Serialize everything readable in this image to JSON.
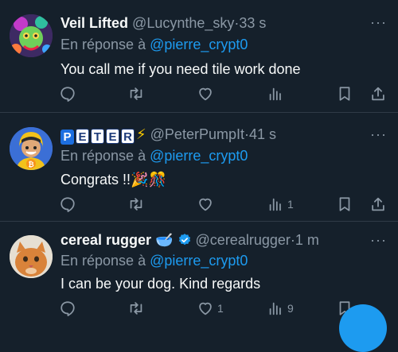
{
  "tweets": [
    {
      "name": "Veil Lifted",
      "handle": "@Lucynthe_sky",
      "time": "33 s",
      "reply_prefix": "En réponse à",
      "reply_to": "@pierre_crypt0",
      "text": "You call me if you need tile work done",
      "more": "···",
      "counts": {
        "reply": "",
        "retweet": "",
        "like": "",
        "views": ""
      }
    },
    {
      "name_letters": [
        "P",
        "E",
        "T",
        "E",
        "R"
      ],
      "name_suffix": "⚡",
      "handle": "@PeterPumpIt",
      "time": "41 s",
      "reply_prefix": "En réponse à",
      "reply_to": "@pierre_crypt0",
      "text": "Congrats !!🎉🎊",
      "more": "···",
      "counts": {
        "reply": "",
        "retweet": "",
        "like": "",
        "views": "1"
      }
    },
    {
      "name": "cereal rugger",
      "name_emoji": "🥣",
      "handle": "@cerealrugger",
      "time": "1 m",
      "reply_prefix": "En réponse à",
      "reply_to": "@pierre_crypt0",
      "text": "I can be your dog. Kind regards",
      "more": "···",
      "counts": {
        "reply": "",
        "retweet": "",
        "like": "1",
        "views": "9"
      }
    }
  ],
  "separator": "·",
  "icons": [
    "reply-icon",
    "retweet-icon",
    "like-icon",
    "views-icon",
    "bookmark-icon",
    "share-icon",
    "verified-icon"
  ],
  "colors": {
    "background": "#15202b",
    "accent": "#1d9bf0",
    "muted": "#8b98a5",
    "text": "#f7f9f9"
  }
}
